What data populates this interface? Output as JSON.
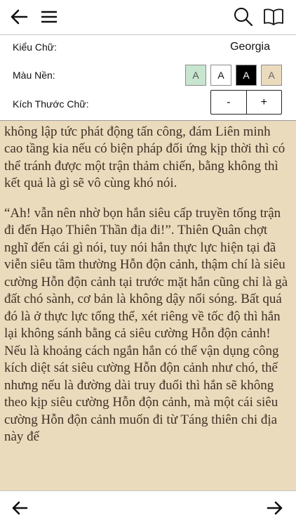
{
  "toolbar": {
    "back_icon": "arrow-left-icon",
    "menu_icon": "hamburger-menu-icon",
    "search_icon": "search-icon",
    "book_icon": "open-book-icon"
  },
  "settings": {
    "font_label": "Kiểu Chữ:",
    "font_value": "Georgia",
    "bg_label": "Màu Nền:",
    "size_label": "Kích Thước Chữ:",
    "swatches": [
      {
        "letter": "A",
        "bg": "#c7e5cf",
        "fg": "#555555"
      },
      {
        "letter": "A",
        "bg": "#ffffff",
        "fg": "#111111"
      },
      {
        "letter": "A",
        "bg": "#000000",
        "fg": "#ffffff"
      },
      {
        "letter": "A",
        "bg": "#ebdbbd",
        "fg": "#666666"
      }
    ],
    "minus_label": "-",
    "plus_label": "+"
  },
  "content": {
    "paragraphs": [
      "chẳng qua là ngay cả hắn cũng không dám chắc, nếu không lập tức phát động tấn công, đám Liên minh cao tầng kia nếu có biện pháp đối ứng kịp thời thì có thể tránh được một trận thảm chiến, bằng không thì kết quả là gì sẽ vô cùng khó nói.",
      "“Ah! vẫn nên nhờ bọn hắn siêu cấp truyền tống trận đi đến Hạo Thiên Thần địa đi!”. Thiên Quân chợt nghĩ đến cái gì nói, tuy nói hắn thực lực hiện tại đã viễn siêu tầm thường Hỗn độn cảnh, thậm chí là siêu cường Hỗn độn cảnh tại trước mặt hắn cũng chỉ là gà đất chó sành, cơ bản là không dậy nổi sóng. Bất quá đó là ở thực lực tổng thể, xét riêng về tốc độ thì hắn lại không sánh bằng cả siêu cường Hỗn độn cảnh! Nếu là khoảng cách ngắn hắn có thể vận dụng công kích diệt sát siêu cường Hỗn độn cảnh như chó, thế nhưng nếu là đường dài truy đuổi thì hắn sẽ không theo kịp siêu cường Hỗn độn cảnh, mà một cái siêu cường Hỗn độn cảnh muốn đi từ Táng thiên chi địa này để"
    ]
  },
  "bottom": {
    "prev_icon": "arrow-left-icon",
    "next_icon": "arrow-right-icon"
  },
  "colors": {
    "page_bg": "#ebdbbd",
    "text": "#3e3125"
  }
}
